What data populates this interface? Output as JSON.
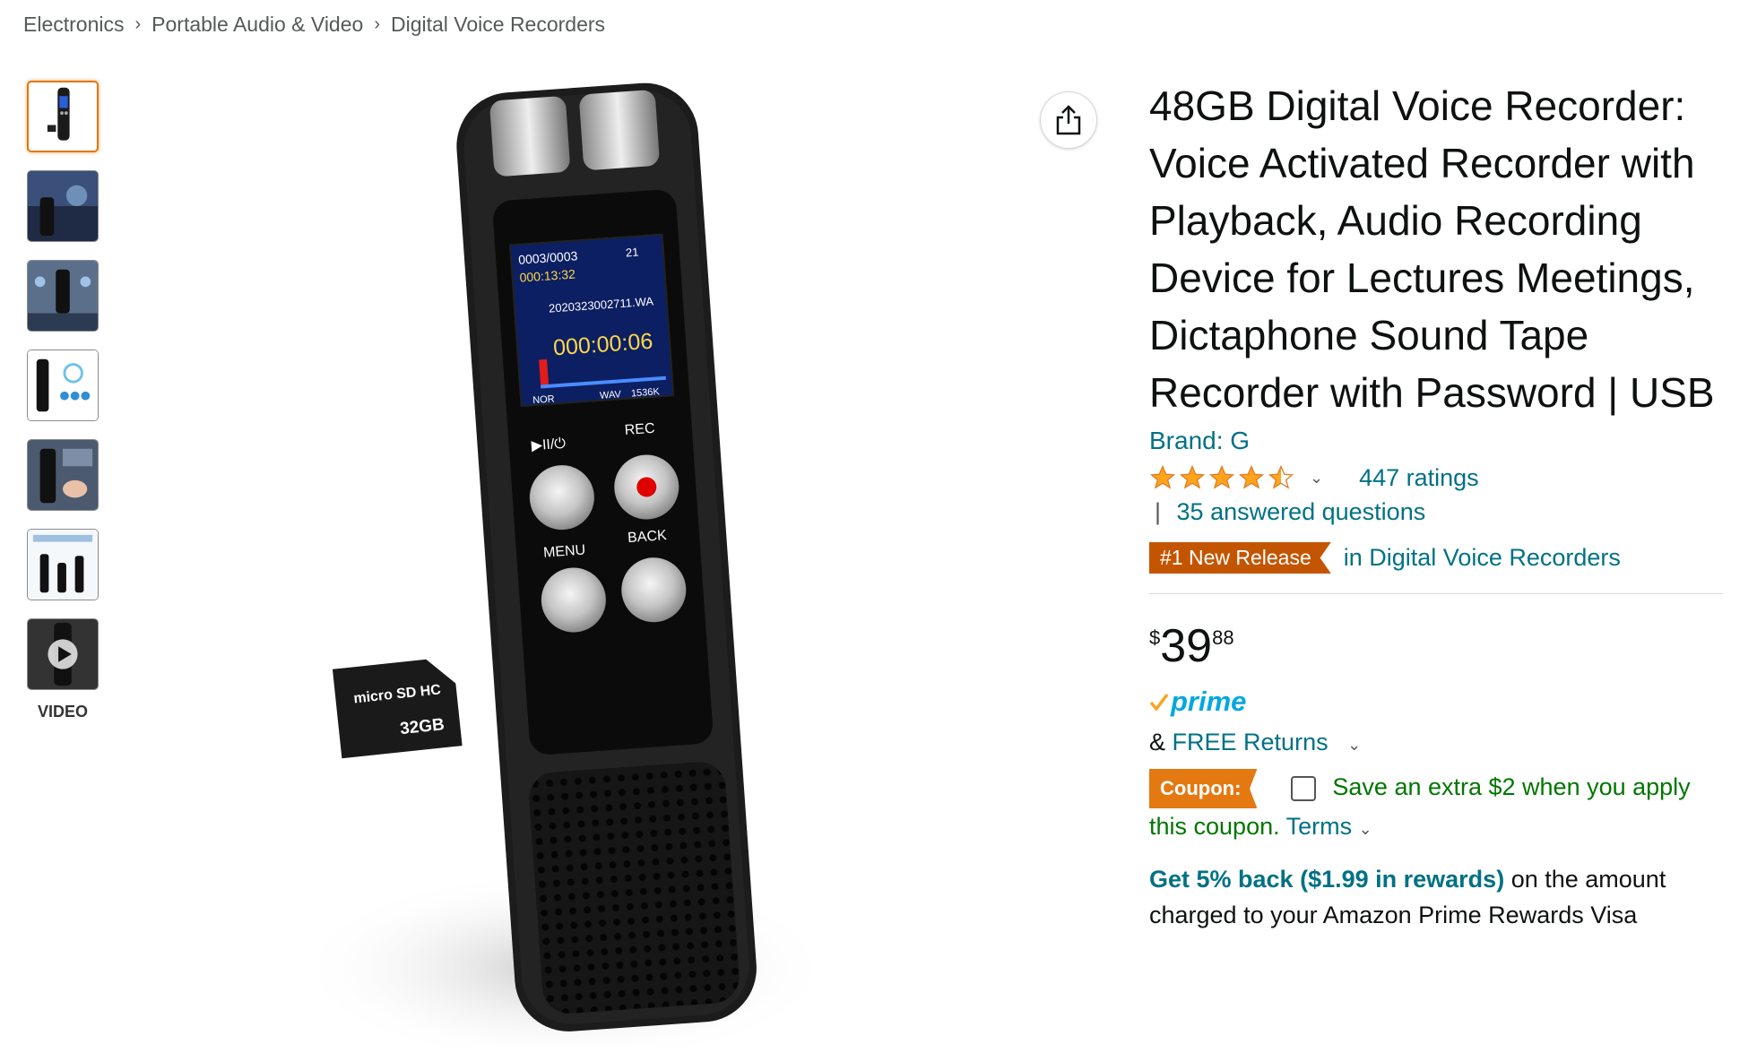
{
  "breadcrumb": [
    "Electronics",
    "Portable Audio & Video",
    "Digital Voice Recorders"
  ],
  "breadcrumb_sep": "›",
  "gallery": {
    "video_label": "VIDEO"
  },
  "device_screen": {
    "track": "0003/0003",
    "duration": "000:13:32",
    "volume": "21",
    "filename": "2020323002711.WA",
    "timer": "000:00:06",
    "tag_nor": "NOR",
    "tag_wav": "WAV",
    "tag_bitrate": "1536K",
    "btn_play": "▶II/⏻",
    "btn_rec": "REC",
    "btn_menu": "MENU",
    "btn_back": "BACK"
  },
  "sd_card": {
    "brand": "micro SD HC",
    "capacity": "32GB"
  },
  "product": {
    "title": "48GB Digital Voice Recorder: Voice Activated Recorder with Playback, Audio Recording Device for Lectures Meetings, Dictaphone Sound Tape Recorder with Password | USB",
    "brand": "Brand: G",
    "rating": 4.5,
    "ratings_count": "447 ratings",
    "qa_sep": "|",
    "answered_questions": "35 answered questions",
    "badge": "#1 New Release",
    "badge_category": "in Digital Voice Recorders",
    "price_currency": "$",
    "price_whole": "39",
    "price_fraction": "88",
    "prime_label": "prime",
    "returns_prefix": "&",
    "returns_link": "FREE Returns",
    "coupon_label": "Coupon:",
    "coupon_text": "Save an extra $2 when you apply this coupon.",
    "coupon_terms": "Terms",
    "rewards_strong": "Get 5% back ($1.99 in rewards)",
    "rewards_rest": "on the amount charged to your Amazon Prime Rewards Visa"
  },
  "colors": {
    "link": "#007185",
    "star": "#ffa41c",
    "badge": "#c45500",
    "coupon": "#e47911",
    "coupon_text": "#007600",
    "prime": "#00a8e1"
  }
}
